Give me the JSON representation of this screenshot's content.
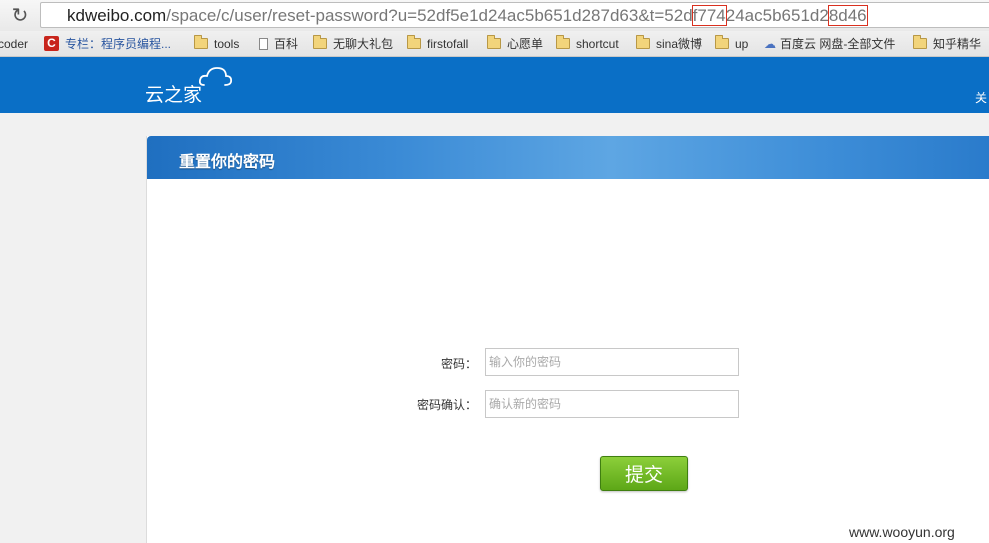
{
  "browser": {
    "url_host": "kdweibo.com",
    "url_part1": "/space/c/user/reset-password?u=52df5e1d24ac5b651d287d63&t=52d",
    "url_highlight1": "f774",
    "url_part2": "24ac5b651d2",
    "url_highlight2": "8d46",
    "reload_icon": "reload-icon"
  },
  "bookmarks": [
    {
      "label": "coder",
      "icon": "none"
    },
    {
      "label": "专栏：程序员编程...",
      "icon": "c-icon"
    },
    {
      "label": "tools",
      "icon": "folder-icon"
    },
    {
      "label": "百科",
      "icon": "page-icon"
    },
    {
      "label": "无聊大礼包",
      "icon": "folder-icon"
    },
    {
      "label": "firstofall",
      "icon": "folder-icon"
    },
    {
      "label": "心愿单",
      "icon": "folder-icon"
    },
    {
      "label": "shortcut",
      "icon": "folder-icon"
    },
    {
      "label": "sina微博",
      "icon": "folder-icon"
    },
    {
      "label": "up",
      "icon": "folder-icon"
    },
    {
      "label": "百度云 网盘-全部文件",
      "icon": "cloud-icon"
    },
    {
      "label": "知乎精华",
      "icon": "folder-icon"
    }
  ],
  "header": {
    "logo_text": "云之家",
    "right_link": "关"
  },
  "form": {
    "title": "重置你的密码",
    "password_label": "密码：",
    "password_placeholder": "输入你的密码",
    "confirm_label": "密码确认：",
    "confirm_placeholder": "确认新的密码",
    "submit_label": "提交"
  },
  "watermark": "www.wooyun.org",
  "colors": {
    "header_blue": "#0a6fc6",
    "submit_green": "#5da717",
    "highlight_red": "#d9301f"
  }
}
